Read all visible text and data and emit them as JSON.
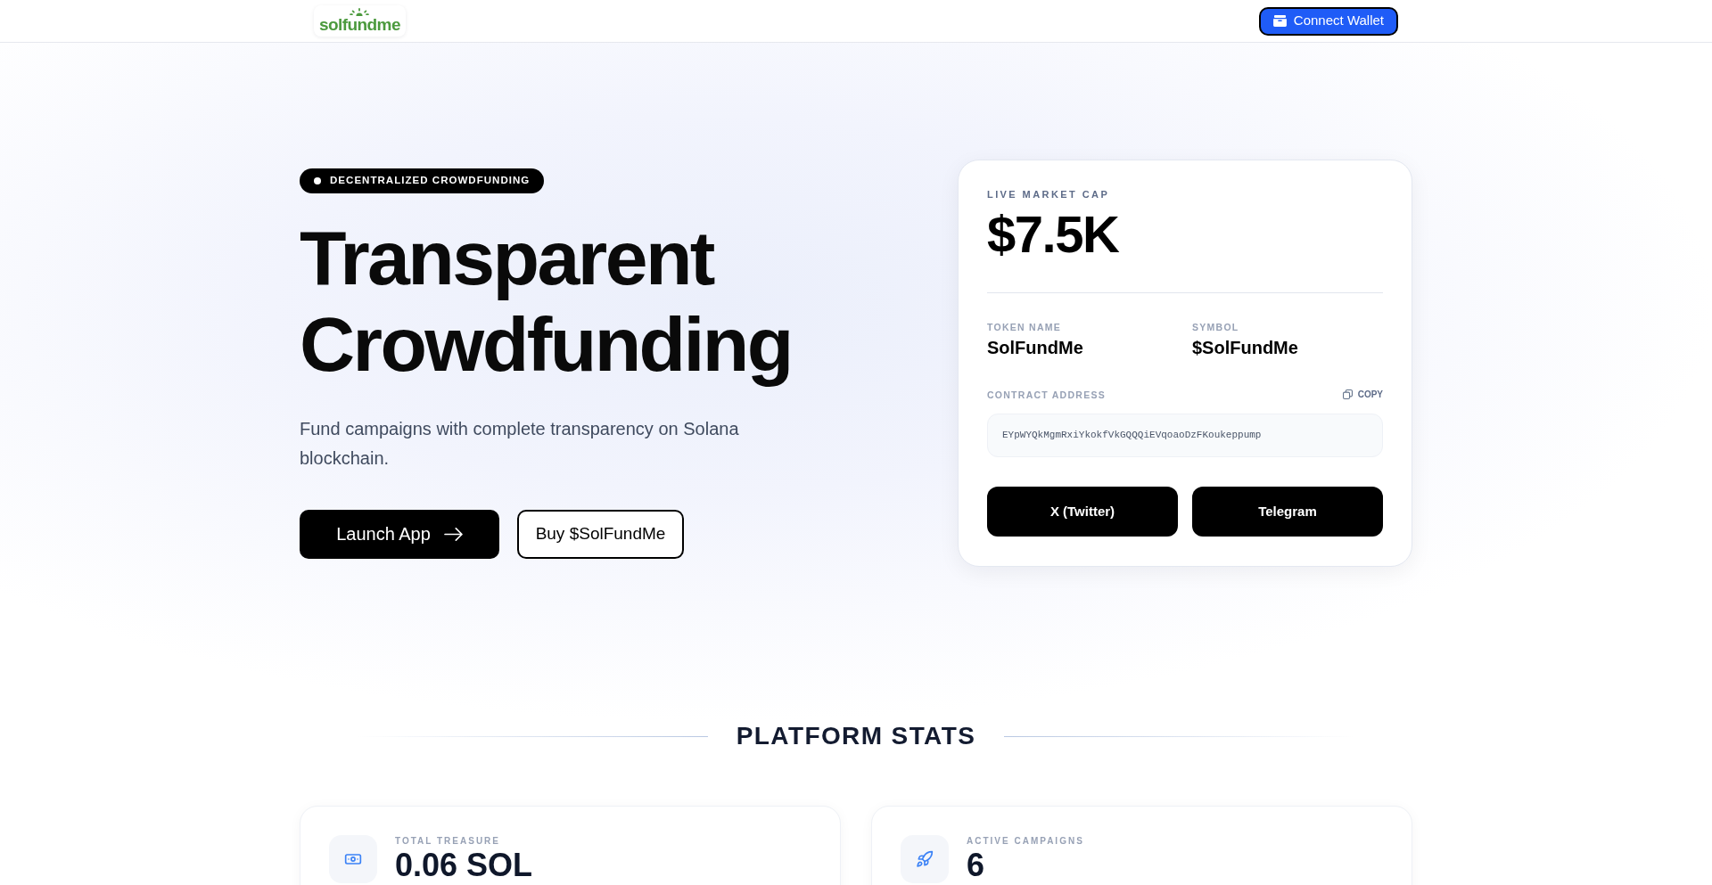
{
  "header": {
    "logo": {
      "text": "solfundme"
    },
    "connect_button": {
      "label": "Connect Wallet"
    }
  },
  "hero": {
    "badge": "DECENTRALIZED CROWDFUNDING",
    "title": "Transparent Crowdfunding",
    "description": "Fund campaigns with complete transparency on Solana blockchain.",
    "buttons": [
      {
        "label": "Launch App",
        "kind": "primary"
      },
      {
        "label": "Buy $SolFundMe",
        "kind": "outline"
      }
    ]
  },
  "token_card": {
    "market_cap_label": "LIVE MARKET CAP",
    "market_cap": "$7.5K",
    "fields": [
      {
        "label": "TOKEN NAME",
        "value": "SolFundMe"
      },
      {
        "label": "SYMBOL",
        "value": "$SolFundMe"
      }
    ],
    "contract": {
      "label": "CONTRACT ADDRESS",
      "copy_label": "COPY",
      "address": "EYpWYQkMgmRxiYkokfVkGQQQiEVqoaoDzFKoukeppump"
    },
    "links": [
      {
        "label": "X (Twitter)"
      },
      {
        "label": "Telegram"
      }
    ]
  },
  "stats": {
    "title": "PLATFORM STATS",
    "cards": [
      {
        "kind": "treasure",
        "label": "TOTAL TREASURE",
        "value": "0.06 SOL"
      },
      {
        "kind": "campaigns",
        "label": "ACTIVE CAMPAIGNS",
        "value": "6"
      }
    ]
  }
}
